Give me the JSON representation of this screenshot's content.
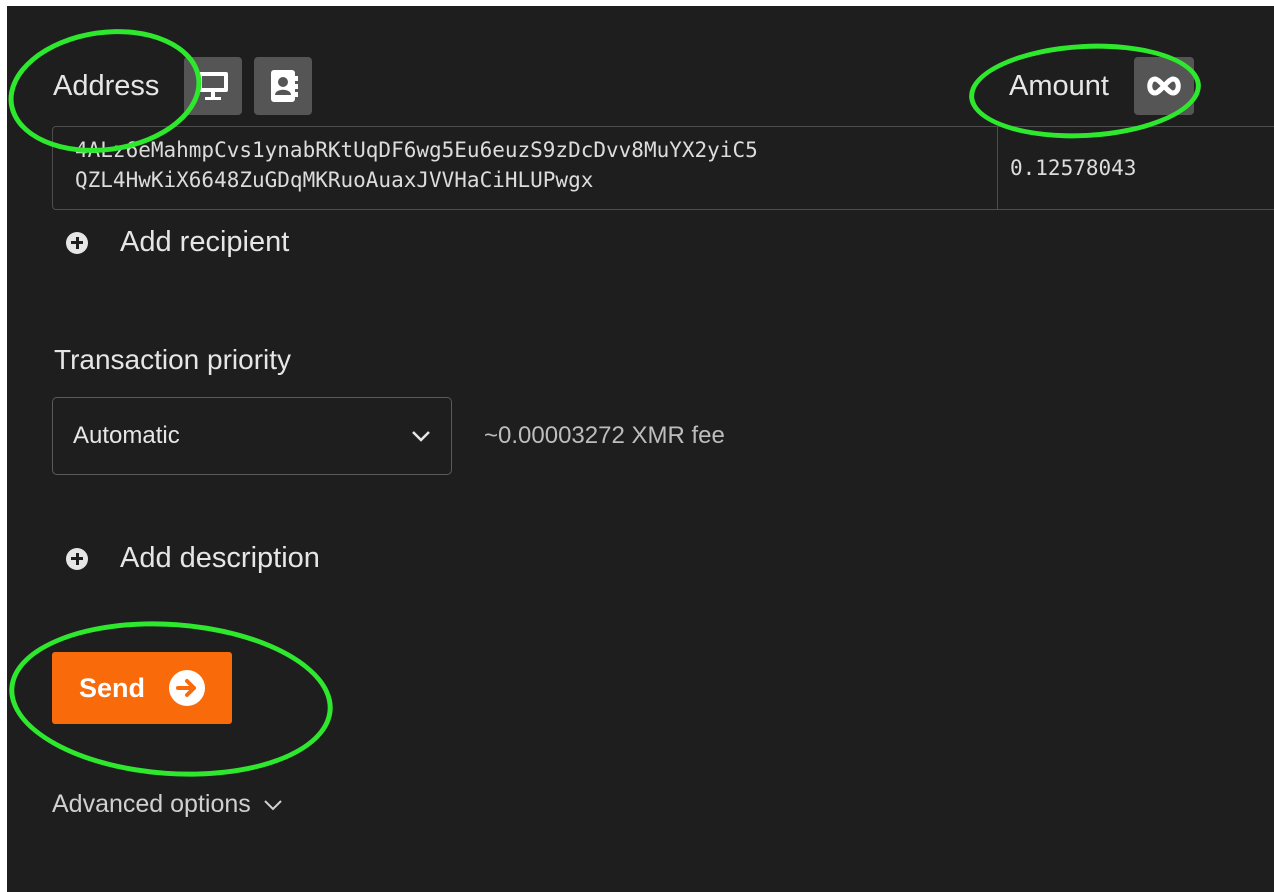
{
  "recipient": {
    "address_label": "Address",
    "amount_label": "Amount",
    "address_lines": [
      "4ALz6eMahmpCvs1ynabRKtUqDF6wg5Eu6euzS9zDcDvv8MuYX2yiC5",
      "QZL4HwKiX6648ZuGDqMKRuoAuaxJVVHaCiHLUPwgx"
    ],
    "amount_value": "0.12578043",
    "icons": [
      "monitor-icon",
      "address-book-icon",
      "infinity-icon"
    ],
    "add_recipient_label": "Add recipient"
  },
  "priority": {
    "label": "Transaction priority",
    "selected": "Automatic",
    "fee_text": "~0.00003272 XMR fee"
  },
  "description": {
    "add_label": "Add description"
  },
  "actions": {
    "send_label": "Send",
    "advanced_label": "Advanced options"
  },
  "colors": {
    "background": "#1e1e1e",
    "accent": "#f86a0a",
    "annotation": "#2ee82e"
  }
}
